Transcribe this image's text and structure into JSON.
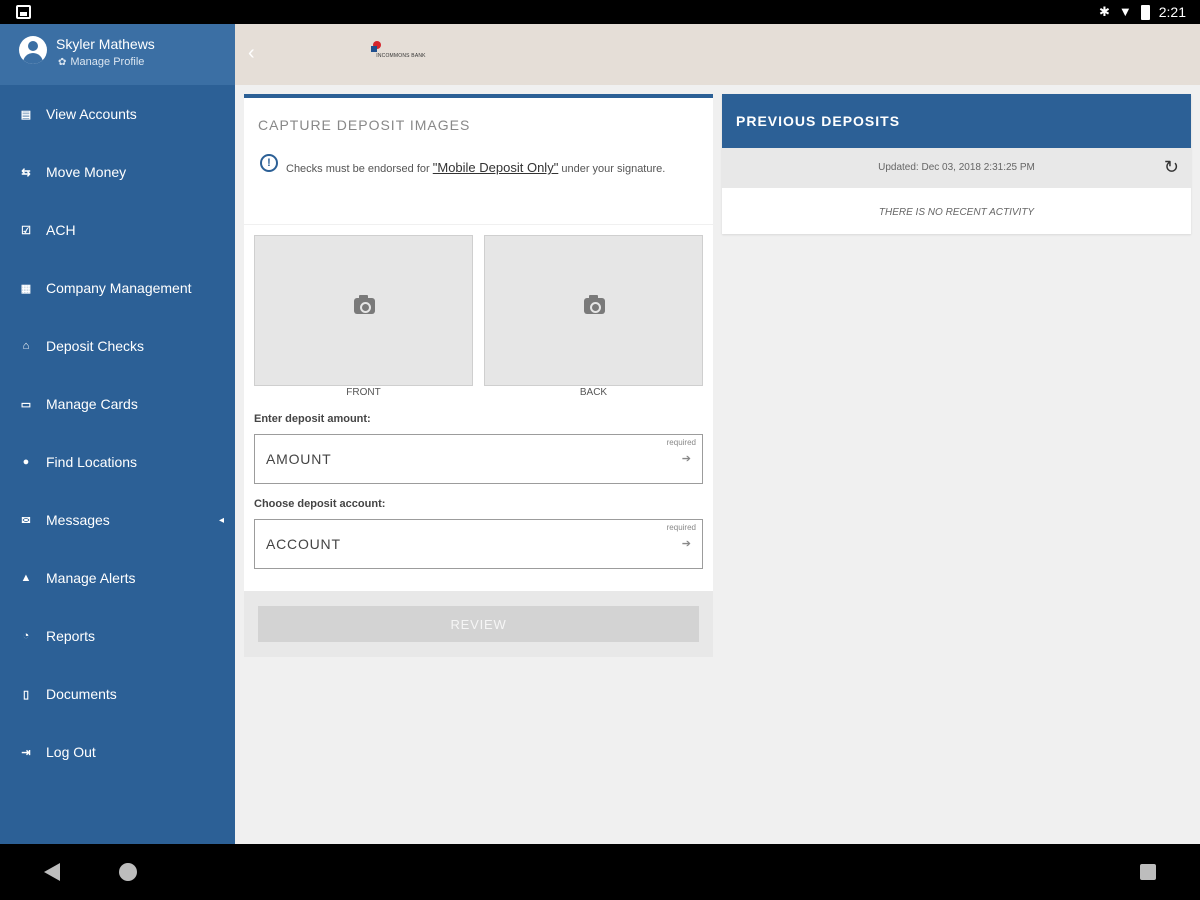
{
  "status_bar": {
    "time": "2:21",
    "icons": [
      "bluetooth-icon",
      "wifi-icon",
      "battery-icon"
    ]
  },
  "sidebar": {
    "profile": {
      "name": "Skyler Mathews",
      "manage_label": "Manage Profile"
    },
    "items": [
      {
        "label": "View Accounts",
        "icon": "accounts-icon",
        "glyph": "▤"
      },
      {
        "label": "Move Money",
        "icon": "move-money-icon",
        "glyph": "⇆"
      },
      {
        "label": "ACH",
        "icon": "ach-icon",
        "glyph": "☑"
      },
      {
        "label": "Company Management",
        "icon": "company-icon",
        "glyph": "▦"
      },
      {
        "label": "Deposit Checks",
        "icon": "bank-icon",
        "glyph": "⌂"
      },
      {
        "label": "Manage Cards",
        "icon": "card-icon",
        "glyph": "▭"
      },
      {
        "label": "Find Locations",
        "icon": "location-pin-icon",
        "glyph": "●"
      },
      {
        "label": "Messages",
        "icon": "envelope-icon",
        "glyph": "✉",
        "caret": "◂"
      },
      {
        "label": "Manage Alerts",
        "icon": "bell-icon",
        "glyph": "▲"
      },
      {
        "label": "Reports",
        "icon": "reports-icon",
        "glyph": "◔"
      },
      {
        "label": "Documents",
        "icon": "document-icon",
        "glyph": "▯"
      },
      {
        "label": "Log Out",
        "icon": "logout-icon",
        "glyph": "⇥"
      }
    ]
  },
  "header": {
    "back_glyph": "‹",
    "logo_text": "INCOMMONS BANK"
  },
  "capture": {
    "title": "CAPTURE DEPOSIT IMAGES",
    "notice_before": "Checks must be endorsed for ",
    "notice_highlight": "\"Mobile Deposit Only\"",
    "notice_after": " under your signature.",
    "front_label": "FRONT",
    "back_label": "BACK",
    "amount_label": "Enter deposit amount:",
    "amount_value": "AMOUNT",
    "account_label": "Choose deposit account:",
    "account_value": "ACCOUNT",
    "required": "required",
    "arrow": "➔",
    "review_label": "REVIEW"
  },
  "previous_deposits": {
    "title": "PREVIOUS DEPOSITS",
    "updated": "Updated: Dec 03, 2018 2:31:25 PM",
    "empty_message": "THERE IS NO RECENT ACTIVITY"
  },
  "colors": {
    "primary": "#2c6096",
    "header_bg": "#e5ded7",
    "profile_bg": "#3b6fa4"
  }
}
